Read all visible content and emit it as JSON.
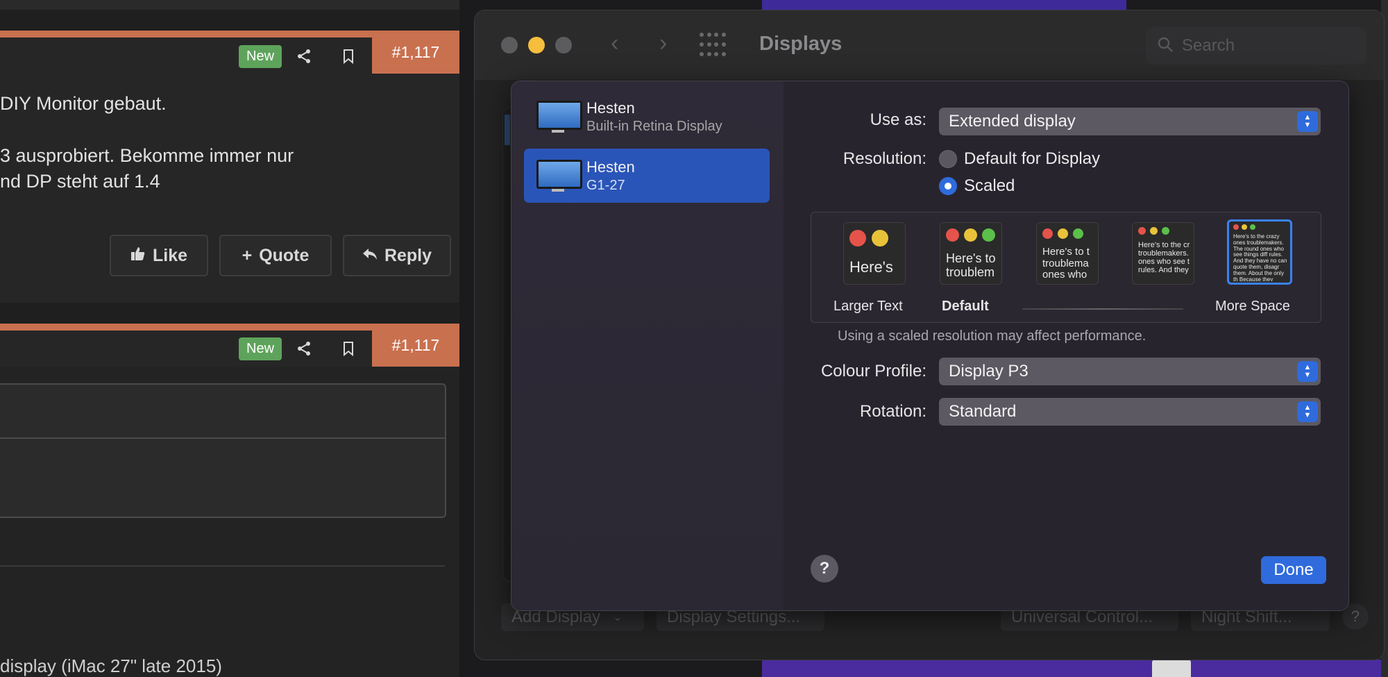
{
  "forum": {
    "posts": [
      {
        "badge": "New",
        "post_number": "#1,117",
        "text_lines": [
          "DIY Monitor gebaut.",
          "3 ausprobiert. Bekomme immer nur",
          "nd DP steht auf 1.4"
        ],
        "buttons": {
          "like": "Like",
          "quote": "Quote",
          "reply": "Reply"
        }
      },
      {
        "badge": "New",
        "post_number": "#1,117",
        "signature": "display (iMac 27\" late 2015)"
      }
    ]
  },
  "syspref": {
    "title": "Displays",
    "search_placeholder": "Search",
    "bottom_buttons": {
      "add_display": "Add Display",
      "display_settings": "Display Settings...",
      "universal_control": "Universal Control...",
      "night_shift": "Night Shift...",
      "help": "?"
    }
  },
  "displays_sheet": {
    "displays": [
      {
        "name": "Hesten",
        "subtitle": "Built-in Retina Display",
        "selected": false
      },
      {
        "name": "Hesten",
        "subtitle": "G1-27",
        "selected": true
      }
    ],
    "use_as": {
      "label": "Use as:",
      "value": "Extended display"
    },
    "resolution": {
      "label": "Resolution:",
      "options": [
        "Default for Display",
        "Scaled"
      ],
      "selected": "Scaled"
    },
    "scale_options": {
      "larger_text": "Larger Text",
      "default": "Default",
      "more_space": "More Space",
      "thumb_texts": [
        "Here's",
        "Here's to troublem",
        "Here's to t troublema ones who",
        "Here's to the cr troublemakers. ones who see t rules. And they",
        "Here's to the crazy ones troublemakers. The round ones who see things diff rules. And they have no can quote them, disagr them. About the only th Because they change th"
      ],
      "selected_index": 4
    },
    "performance_note": "Using a scaled resolution may affect performance.",
    "colour_profile": {
      "label": "Colour Profile:",
      "value": "Display P3"
    },
    "rotation": {
      "label": "Rotation:",
      "value": "Standard"
    },
    "help": "?",
    "done": "Done"
  },
  "colors": {
    "accent_blue": "#2f6bdc",
    "selected_row": "#2a55b8",
    "forum_orange": "#c9704f",
    "badge_green": "#5ea35b",
    "traffic_close": "#5c5c5e",
    "traffic_minimize": "#f5be3d",
    "traffic_zoom": "#5c5c5e"
  }
}
